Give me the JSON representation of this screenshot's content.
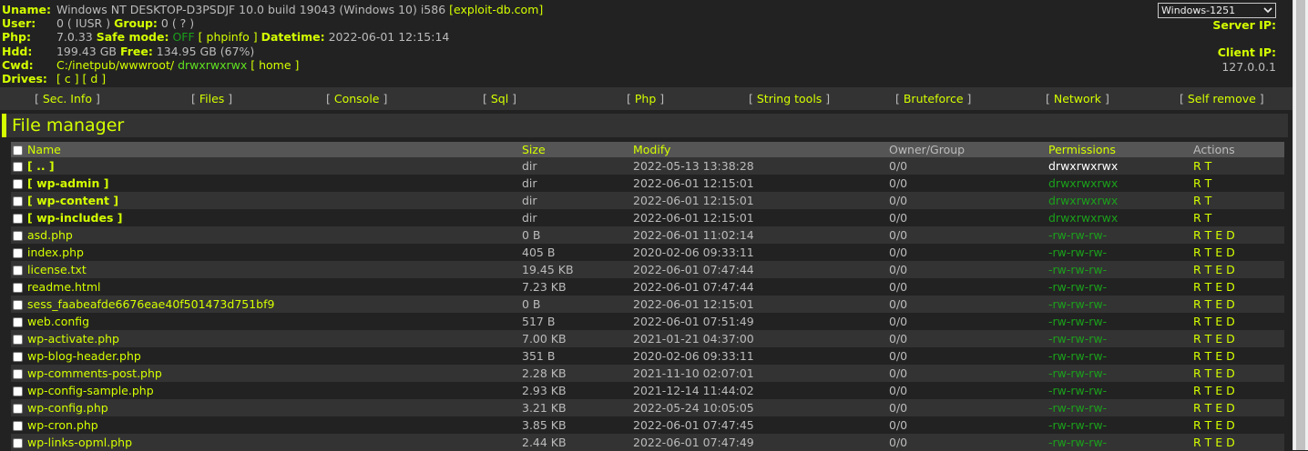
{
  "header": {
    "uname_label": "Uname:",
    "uname_value": "Windows NT DESKTOP-D3PSDJF 10.0 build 19043 (Windows 10) i586",
    "uname_link": "[exploit-db.com]",
    "user_label": "User:",
    "user_value": "0 ( IUSR )",
    "group_label": "Group:",
    "group_value": "0 ( ? )",
    "php_label": "Php:",
    "php_value": "7.0.33",
    "safe_mode_label": "Safe mode:",
    "safe_mode_value": "OFF",
    "phpinfo_link": "[ phpinfo ]",
    "datetime_label": "Datetime:",
    "datetime_value": "2022-06-01 12:15:14",
    "hdd_label": "Hdd:",
    "hdd_value": "199.43 GB",
    "free_label": "Free:",
    "free_value": "134.95 GB (67%)",
    "cwd_label": "Cwd:",
    "cwd_path": "C:/inetpub/wwwroot/",
    "cwd_perm": "drwxrwxrwx",
    "home_link": "[ home ]",
    "drives_label": "Drives:",
    "drive_c": "[ c ]",
    "drive_d": "[ d ]",
    "encoding": "Windows-1251",
    "server_ip_label": "Server IP:",
    "client_ip_label": "Client IP:",
    "client_ip_value": "127.0.0.1"
  },
  "menu": [
    "Sec. Info",
    "Files",
    "Console",
    "Sql",
    "Php",
    "String tools",
    "Bruteforce",
    "Network",
    "Self remove"
  ],
  "file_manager": {
    "title": "File manager",
    "columns": [
      "Name",
      "Size",
      "Modify",
      "Owner/Group",
      "Permissions",
      "Actions"
    ],
    "rows": [
      {
        "name": "[ .. ]",
        "size": "dir",
        "modify": "2022-05-13 13:38:28",
        "owner": "0/0",
        "perms": "drwxrwxrwx",
        "actions": "R T",
        "type": "dir",
        "perm_style": "w"
      },
      {
        "name": "[ wp-admin ]",
        "size": "dir",
        "modify": "2022-06-01 12:15:01",
        "owner": "0/0",
        "perms": "drwxrwxrwx",
        "actions": "R T",
        "type": "dir",
        "perm_style": "g"
      },
      {
        "name": "[ wp-content ]",
        "size": "dir",
        "modify": "2022-06-01 12:15:01",
        "owner": "0/0",
        "perms": "drwxrwxrwx",
        "actions": "R T",
        "type": "dir",
        "perm_style": "g"
      },
      {
        "name": "[ wp-includes ]",
        "size": "dir",
        "modify": "2022-06-01 12:15:01",
        "owner": "0/0",
        "perms": "drwxrwxrwx",
        "actions": "R T",
        "type": "dir",
        "perm_style": "g"
      },
      {
        "name": "asd.php",
        "size": "0 B",
        "modify": "2022-06-01 11:02:14",
        "owner": "0/0",
        "perms": "-rw-rw-rw-",
        "actions": "R T E D",
        "type": "file",
        "perm_style": "g"
      },
      {
        "name": "index.php",
        "size": "405 B",
        "modify": "2020-02-06 09:33:11",
        "owner": "0/0",
        "perms": "-rw-rw-rw-",
        "actions": "R T E D",
        "type": "file",
        "perm_style": "g"
      },
      {
        "name": "license.txt",
        "size": "19.45 KB",
        "modify": "2022-06-01 07:47:44",
        "owner": "0/0",
        "perms": "-rw-rw-rw-",
        "actions": "R T E D",
        "type": "file",
        "perm_style": "g"
      },
      {
        "name": "readme.html",
        "size": "7.23 KB",
        "modify": "2022-06-01 07:47:44",
        "owner": "0/0",
        "perms": "-rw-rw-rw-",
        "actions": "R T E D",
        "type": "file",
        "perm_style": "g"
      },
      {
        "name": "sess_faabeafde6676eae40f501473d751bf9",
        "size": "0 B",
        "modify": "2022-06-01 12:15:01",
        "owner": "0/0",
        "perms": "-rw-rw-rw-",
        "actions": "R T E D",
        "type": "file",
        "perm_style": "g"
      },
      {
        "name": "web.config",
        "size": "517 B",
        "modify": "2022-06-01 07:51:49",
        "owner": "0/0",
        "perms": "-rw-rw-rw-",
        "actions": "R T E D",
        "type": "file",
        "perm_style": "g"
      },
      {
        "name": "wp-activate.php",
        "size": "7.00 KB",
        "modify": "2021-01-21 04:37:00",
        "owner": "0/0",
        "perms": "-rw-rw-rw-",
        "actions": "R T E D",
        "type": "file",
        "perm_style": "g"
      },
      {
        "name": "wp-blog-header.php",
        "size": "351 B",
        "modify": "2020-02-06 09:33:11",
        "owner": "0/0",
        "perms": "-rw-rw-rw-",
        "actions": "R T E D",
        "type": "file",
        "perm_style": "g"
      },
      {
        "name": "wp-comments-post.php",
        "size": "2.28 KB",
        "modify": "2021-11-10 02:07:01",
        "owner": "0/0",
        "perms": "-rw-rw-rw-",
        "actions": "R T E D",
        "type": "file",
        "perm_style": "g"
      },
      {
        "name": "wp-config-sample.php",
        "size": "2.93 KB",
        "modify": "2021-12-14 11:44:02",
        "owner": "0/0",
        "perms": "-rw-rw-rw-",
        "actions": "R T E D",
        "type": "file",
        "perm_style": "g"
      },
      {
        "name": "wp-config.php",
        "size": "3.21 KB",
        "modify": "2022-05-24 10:05:05",
        "owner": "0/0",
        "perms": "-rw-rw-rw-",
        "actions": "R T E D",
        "type": "file",
        "perm_style": "g"
      },
      {
        "name": "wp-cron.php",
        "size": "3.85 KB",
        "modify": "2022-06-01 07:47:45",
        "owner": "0/0",
        "perms": "-rw-rw-rw-",
        "actions": "R T E D",
        "type": "file",
        "perm_style": "g"
      },
      {
        "name": "wp-links-opml.php",
        "size": "2.44 KB",
        "modify": "2022-06-01 07:47:49",
        "owner": "0/0",
        "perms": "-rw-rw-rw-",
        "actions": "R T E D",
        "type": "file",
        "perm_style": "g"
      }
    ]
  },
  "colors": {
    "accent": "#d4ff00",
    "background": "#222222",
    "row_alt": "#333333",
    "header_row": "#555555",
    "perm_green": "#1ba01b"
  }
}
